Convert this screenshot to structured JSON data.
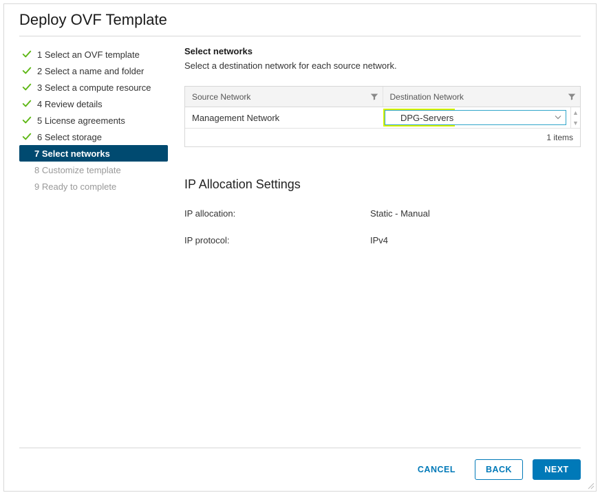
{
  "dialog": {
    "title": "Deploy OVF Template"
  },
  "nav": {
    "items": [
      {
        "num": "1",
        "label": "Select an OVF template",
        "state": "completed"
      },
      {
        "num": "2",
        "label": "Select a name and folder",
        "state": "completed"
      },
      {
        "num": "3",
        "label": "Select a compute resource",
        "state": "completed"
      },
      {
        "num": "4",
        "label": "Review details",
        "state": "completed"
      },
      {
        "num": "5",
        "label": "License agreements",
        "state": "completed"
      },
      {
        "num": "6",
        "label": "Select storage",
        "state": "completed"
      },
      {
        "num": "7",
        "label": "Select networks",
        "state": "active"
      },
      {
        "num": "8",
        "label": "Customize template",
        "state": "future"
      },
      {
        "num": "9",
        "label": "Ready to complete",
        "state": "future"
      }
    ]
  },
  "main": {
    "section_title": "Select networks",
    "section_subtitle": "Select a destination network for each source network.",
    "table": {
      "col_source": "Source Network",
      "col_dest": "Destination Network",
      "rows": [
        {
          "source": "Management Network",
          "destination": "DPG-Servers"
        }
      ],
      "footer_count": "1 items"
    },
    "ip_settings": {
      "title": "IP Allocation Settings",
      "allocation_label": "IP allocation:",
      "allocation_value": "Static - Manual",
      "protocol_label": "IP protocol:",
      "protocol_value": "IPv4"
    }
  },
  "footer": {
    "cancel": "CANCEL",
    "back": "BACK",
    "next": "NEXT"
  }
}
